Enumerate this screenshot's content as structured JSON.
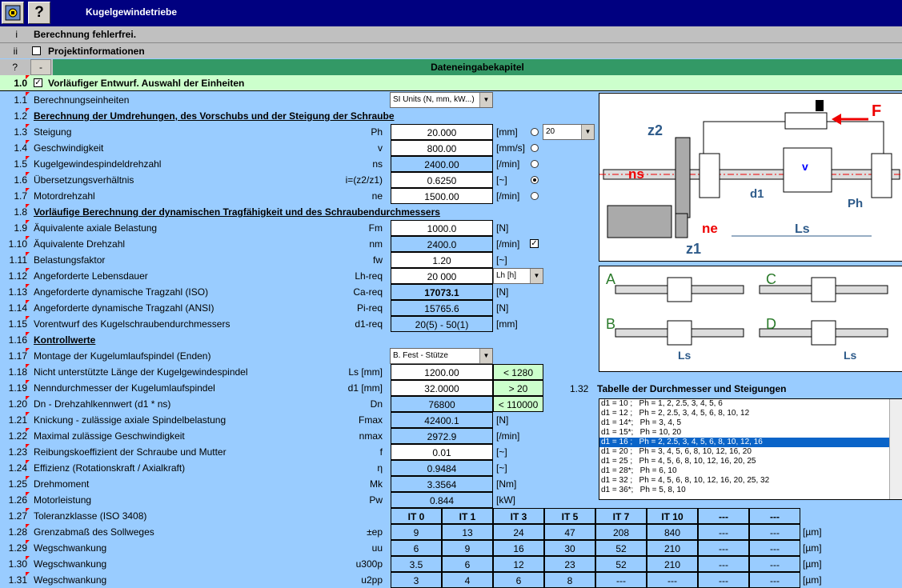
{
  "app": {
    "title": "Kugelgewindetriebe",
    "settings_icon": "settings-icon",
    "help_label": "?"
  },
  "info": [
    {
      "num": "i",
      "label": "Berechnung fehlerfrei."
    },
    {
      "num": "ii",
      "label": "Projektinformationen"
    }
  ],
  "chapter": {
    "num": "?",
    "collapse": "-",
    "title": "Dateneingabekapitel"
  },
  "section1": {
    "num": "1.0",
    "title": "Vorläufiger Entwurf. Auswahl der Einheiten"
  },
  "rows": {
    "r11": {
      "num": "1.1",
      "label": "Berechnungseinheiten",
      "select": "SI Units (N, mm, kW...)"
    },
    "r12": {
      "num": "1.2",
      "label": "Berechnung der Umdrehungen, des Vorschubs und der Steigung der Schraube"
    },
    "r13": {
      "num": "1.3",
      "label": "Steigung",
      "sym": "Ph",
      "val": "20.000",
      "unit": "[mm]",
      "select": "20"
    },
    "r14": {
      "num": "1.4",
      "label": "Geschwindigkeit",
      "sym": "v",
      "val": "800.00",
      "unit": "[mm/s]"
    },
    "r15": {
      "num": "1.5",
      "label": "Kugelgewindespindeldrehzahl",
      "sym": "ns",
      "val": "2400.00",
      "unit": "[/min]"
    },
    "r16": {
      "num": "1.6",
      "label": "Übersetzungsverhältnis",
      "sym": "i=(z2/z1)",
      "val": "0.6250",
      "unit": "[~]"
    },
    "r17": {
      "num": "1.7",
      "label": "Motordrehzahl",
      "sym": "ne",
      "val": "1500.00",
      "unit": "[/min]"
    },
    "r18": {
      "num": "1.8",
      "label": "Vorläufige Berechnung der dynamischen Tragfähigkeit und des Schraubendurchmessers"
    },
    "r19": {
      "num": "1.9",
      "label": "Äquivalente axiale Belastung",
      "sym": "Fm",
      "val": "1000.0",
      "unit": "[N]"
    },
    "r110": {
      "num": "1.10",
      "label": "Äquivalente Drehzahl",
      "sym": "nm",
      "val": "2400.0",
      "unit": "[/min]"
    },
    "r111": {
      "num": "1.11",
      "label": "Belastungsfaktor",
      "sym": "fw",
      "val": "1.20",
      "unit": "[~]"
    },
    "r112": {
      "num": "1.12",
      "label": "Angeforderte Lebensdauer",
      "sym": "Lh-req",
      "val": "20 000",
      "select": "Lh [h]"
    },
    "r113": {
      "num": "1.13",
      "label": "Angeforderte dynamische Tragzahl (ISO)",
      "sym": "Ca-req",
      "val": "17073.1",
      "unit": "[N]"
    },
    "r114": {
      "num": "1.14",
      "label": "Angeforderte dynamische Tragzahl (ANSI)",
      "sym": "Pi-req",
      "val": "15765.6",
      "unit": "[N]"
    },
    "r115": {
      "num": "1.15",
      "label": "Vorentwurf des Kugelschraubendurchmessers",
      "sym": "d1-req",
      "val": "20(5) - 50(1)",
      "unit": "[mm]"
    },
    "r116": {
      "num": "1.16",
      "label": "Kontrollwerte"
    },
    "r117": {
      "num": "1.17",
      "label": "Montage der Kugelumlaufspindel (Enden)",
      "select": "B. Fest - Stütze"
    },
    "r118": {
      "num": "1.18",
      "label": "Nicht unterstützte Länge der Kugelgewindespindel",
      "sym": "Ls [mm]",
      "val": "1200.00",
      "check": "< 1280"
    },
    "r119": {
      "num": "1.19",
      "label": "Nenndurchmesser der Kugelumlaufspindel",
      "sym": "d1 [mm]",
      "val": "32.0000",
      "check": "> 20"
    },
    "r120": {
      "num": "1.20",
      "label": "Dn - Drehzahlkennwert (d1 * ns)",
      "sym": "Dn",
      "val": "76800",
      "check": "< 110000"
    },
    "r121": {
      "num": "1.21",
      "label": "Knickung - zulässige axiale Spindelbelastung",
      "sym": "Fmax",
      "val": "42400.1",
      "unit": "[N]"
    },
    "r122": {
      "num": "1.22",
      "label": "Maximal zulässige Geschwindigkeit",
      "sym": "nmax",
      "val": "2972.9",
      "unit": "[/min]"
    },
    "r123": {
      "num": "1.23",
      "label": "Reibungskoeffizient der Schraube und Mutter",
      "sym": "f",
      "val": "0.01",
      "unit": "[~]"
    },
    "r124": {
      "num": "1.24",
      "label": "Effizienz (Rotationskraft / Axialkraft)",
      "sym": "η",
      "val": "0.9484",
      "unit": "[~]"
    },
    "r125": {
      "num": "1.25",
      "label": "Drehmoment",
      "sym": "Mk",
      "val": "3.3564",
      "unit": "[Nm]"
    },
    "r126": {
      "num": "1.26",
      "label": "Motorleistung",
      "sym": "Pw",
      "val": "0.844",
      "unit": "[kW]"
    }
  },
  "tolerance": {
    "r127": {
      "num": "1.27",
      "label": "Toleranzklasse (ISO 3408)"
    },
    "headers": [
      "IT 0",
      "IT 1",
      "IT 3",
      "IT 5",
      "IT 7",
      "IT 10",
      "---",
      "---"
    ],
    "rows": [
      {
        "num": "1.28",
        "label": "Grenzabmaß des Sollweges",
        "sym": "±ep",
        "cells": [
          "9",
          "13",
          "24",
          "47",
          "208",
          "840",
          "---",
          "---"
        ],
        "unit": "[µm]"
      },
      {
        "num": "1.29",
        "label": "Wegschwankung",
        "sym": "uu",
        "cells": [
          "6",
          "9",
          "16",
          "30",
          "52",
          "210",
          "---",
          "---"
        ],
        "unit": "[µm]"
      },
      {
        "num": "1.30",
        "label": "Wegschwankung",
        "sym": "u300p",
        "cells": [
          "3.5",
          "6",
          "12",
          "23",
          "52",
          "210",
          "---",
          "---"
        ],
        "unit": "[µm]"
      },
      {
        "num": "1.31",
        "label": "Wegschwankung",
        "sym": "u2pp",
        "cells": [
          "3",
          "4",
          "6",
          "8",
          "---",
          "---",
          "---",
          "---"
        ],
        "unit": "[µm]"
      }
    ]
  },
  "table132": {
    "num": "1.32",
    "title": "Tabelle der Durchmesser und Steigungen",
    "items": [
      "d1 = 10 ;   Ph = 1, 2, 2.5, 3, 4, 5, 6",
      "d1 = 12 ;   Ph = 2, 2.5, 3, 4, 5, 6, 8, 10, 12",
      "d1 = 14*;   Ph = 3, 4, 5",
      "d1 = 15*;   Ph = 10, 20",
      "d1 = 16 ;   Ph = 2, 2.5, 3, 4, 5, 6, 8, 10, 12, 16",
      "d1 = 20 ;   Ph = 3, 4, 5, 6, 8, 10, 12, 16, 20",
      "d1 = 25 ;   Ph = 4, 5, 6, 8, 10, 12, 16, 20, 25",
      "d1 = 28*;   Ph = 6, 10",
      "d1 = 32 ;   Ph = 4, 5, 6, 8, 10, 12, 16, 20, 25, 32",
      "d1 = 36*;   Ph = 5, 8, 10"
    ],
    "selected": 4
  },
  "diagram": {
    "z2": "z2",
    "F": "F",
    "ns": "ns",
    "v": "v",
    "d1": "d1",
    "Ph": "Ph",
    "ne": "ne",
    "Ls": "Ls",
    "z1": "z1"
  },
  "mounting": {
    "A": "A",
    "B": "B",
    "C": "C",
    "D": "D",
    "Ls_b": "Ls",
    "Ls_d": "Ls"
  }
}
